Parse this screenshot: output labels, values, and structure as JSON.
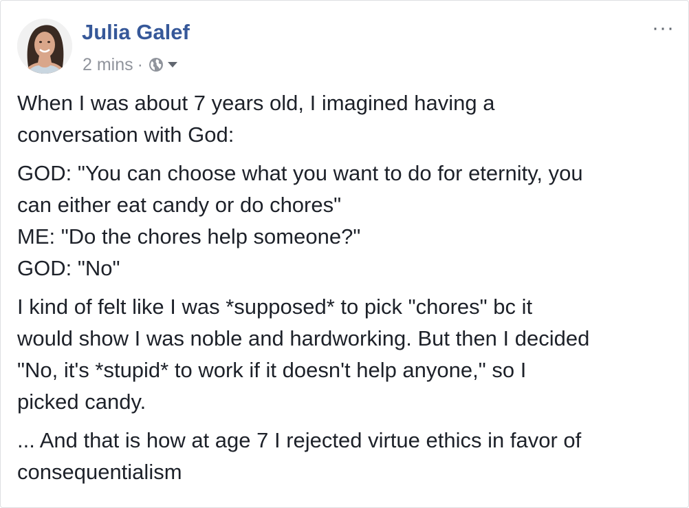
{
  "post": {
    "author": "Julia Galef",
    "time": "2 mins",
    "separator": "·",
    "privacy_icon": "globe-icon",
    "menu_icon": "more-options-icon",
    "menu_label": "···",
    "paragraphs": [
      {
        "lines": [
          "When I was about 7 years old, I imagined having a",
          "conversation with God:"
        ]
      },
      {
        "lines": [
          "GOD: \"You can choose what you want to do for eternity, you",
          "can either eat candy or do chores\"",
          "ME: \"Do the chores help someone?\"",
          "GOD: \"No\""
        ]
      },
      {
        "lines": [
          "I kind of felt like I was *supposed* to pick \"chores\" bc it",
          "would show I was noble and hardworking. But then I decided",
          "\"No, it's *stupid* to work if it doesn't help anyone,\" so I",
          "picked candy."
        ]
      },
      {
        "lines": [
          "... And that is how at age 7 I rejected virtue ethics in favor of",
          "consequentialism"
        ]
      }
    ]
  },
  "colors": {
    "author": "#365899",
    "meta": "#90949c",
    "text": "#1d2129",
    "border": "#dddfe2"
  }
}
